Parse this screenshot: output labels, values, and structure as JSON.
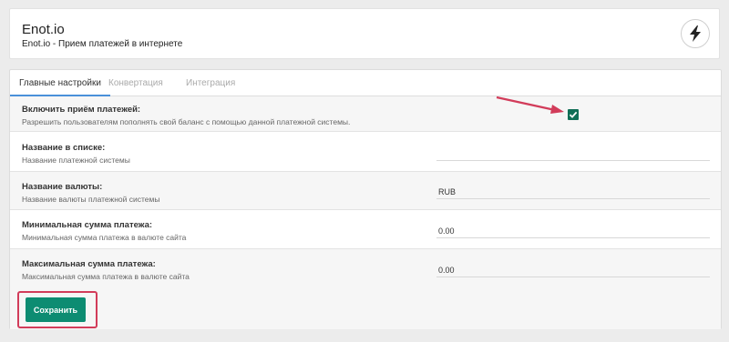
{
  "header": {
    "title": "Enot.io",
    "subtitle": "Enot.io - Прием платежей в интернете",
    "icon": "lightning-bolt-icon"
  },
  "tabs": [
    {
      "label": "Главные настройки",
      "active": true
    },
    {
      "label": "Конвертация",
      "active": false
    },
    {
      "label": "Интеграция",
      "active": false
    }
  ],
  "settings": {
    "enable": {
      "title": "Включить приём платежей:",
      "description": "Разрешить пользователям пополнять свой баланс с помощью данной платежной системы.",
      "checked": true
    },
    "list_name": {
      "title": "Название в списке:",
      "description": "Название платежной системы",
      "value": ""
    },
    "currency_name": {
      "title": "Название валюты:",
      "description": "Название валюты платежной системы",
      "value": "RUB"
    },
    "min_amount": {
      "title": "Минимальная сумма платежа:",
      "description": "Минимальная сумма платежа в валюте сайта",
      "value": "0.00"
    },
    "max_amount": {
      "title": "Максимальная сумма платежа:",
      "description": "Максимальная сумма платежа в валюте сайта",
      "value": "0.00"
    }
  },
  "footer": {
    "save_label": "Сохранить"
  },
  "colors": {
    "accent": "#0d8c72",
    "annotation": "#d23c5a",
    "tab_underline": "#4a90d9"
  }
}
